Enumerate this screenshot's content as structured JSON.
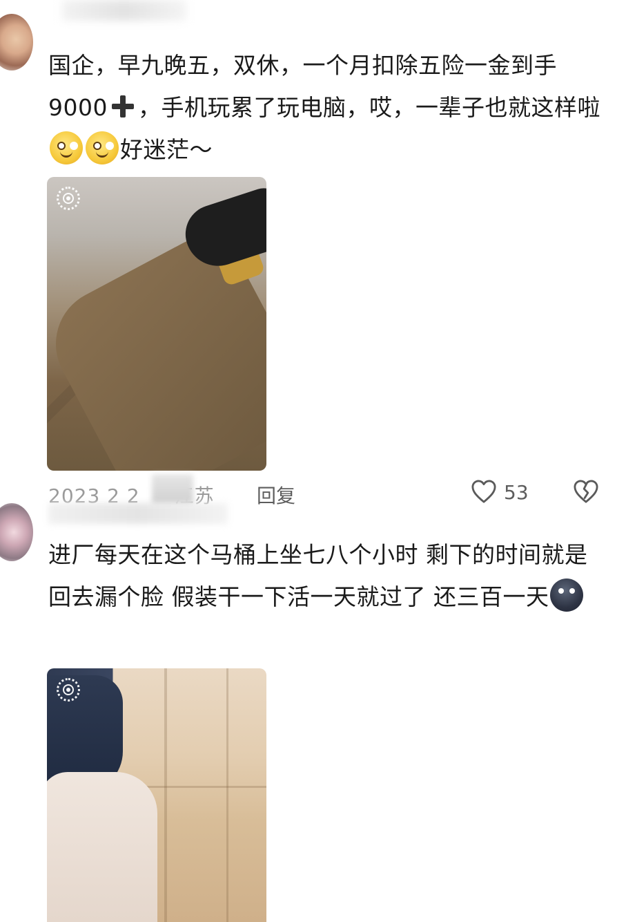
{
  "comments": [
    {
      "text_parts": {
        "a": "国企，早九晚五，双休，一个月扣除五险一金到手9000",
        "b": "，手机玩累了玩电脑，哎，一辈子也就这样啦",
        "c": "好迷茫～"
      },
      "emojis": [
        "plus-emoji",
        "smile-emoji",
        "smile-emoji"
      ],
      "meta": {
        "date": "2023 2 2",
        "location": "江苏",
        "reply": "回复",
        "likes": "53"
      }
    },
    {
      "text_parts": {
        "a": "进厂每天在这个马桶上坐七八个小时 剩下的时间就是回去漏个脸 假装干一下活一天就过了 还三百一天"
      },
      "emojis": [
        "dark-face-emoji"
      ]
    }
  ],
  "icons": {
    "live_photo": "live-photo-icon",
    "like": "heart-outline-icon",
    "dislike": "broken-heart-icon"
  },
  "colors": {
    "text": "#1a1a1a",
    "meta_text": "#8e8e8e",
    "reply_text": "#5d5d5d",
    "background": "#ffffff"
  }
}
